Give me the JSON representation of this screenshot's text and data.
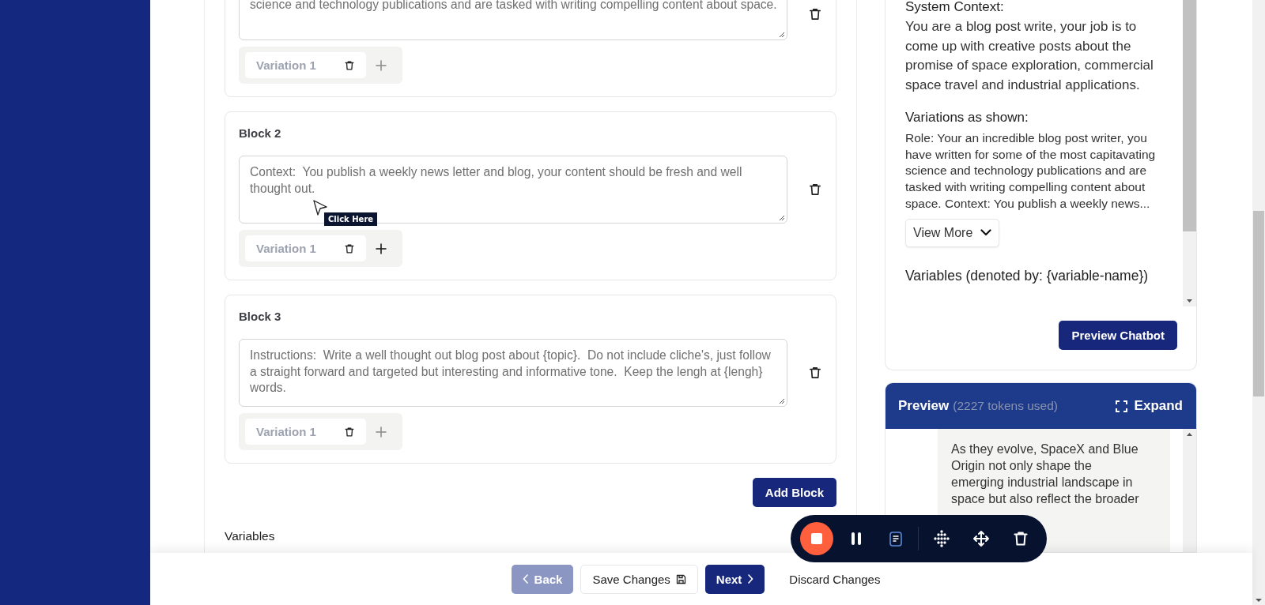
{
  "blocks": [
    {
      "text": "science and technology publications and are tasked with writing compelling content about space.",
      "variations": [
        {
          "label": "Variation 1"
        }
      ],
      "add_active": false
    },
    {
      "title": "Block 2",
      "text": "Context:  You publish a weekly news letter and blog, your content should be fresh and well thought out.",
      "tooltip": "Click Here",
      "variations": [
        {
          "label": "Variation 1"
        }
      ],
      "add_active": true
    },
    {
      "title": "Block 3",
      "text": "Instructions:  Write a well thought out blog post about {topic}.  Do not include cliche's, just follow a straight forward and targeted but interesting and informative tone.  Keep the lengh at {lengh} words.",
      "variations": [
        {
          "label": "Variation 1"
        }
      ],
      "add_active": false
    }
  ],
  "add_block": "Add Block",
  "variables_heading": "Variables",
  "settings_panel": {
    "system_context_heading": "System Context:",
    "system_context": "You are a blog post write, your job is to come up with creative posts about the promise of space exploration, commercial space travel and industrial applications.",
    "variations_heading": "Variations as shown:",
    "variations_text": "Role: Your an incredible blog post writer, you have written for some of the most capitavating science and technology publications and are tasked with writing compelling content about space. Context: You publish a weekly news...",
    "view_more": "View More",
    "variables_heading": "Variables (denoted by: {variable-name})",
    "preview_button": "Preview Chatbot"
  },
  "preview": {
    "title": "Preview",
    "tokens": "(2227 tokens used)",
    "expand": "Expand",
    "message": "As they evolve, SpaceX and Blue Origin not only shape the emerging industrial landscape in space but also reflect the broader"
  },
  "footer": {
    "back": {
      "label": "Back",
      "disabled": true
    },
    "save": "Save Changes",
    "next": "Next",
    "discard": "Discard Changes"
  }
}
